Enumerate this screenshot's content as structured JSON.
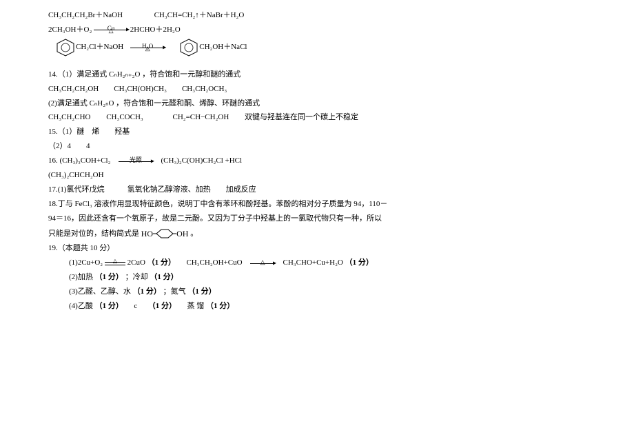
{
  "l1a": "CH₃CH₂CH₂Br＋NaOH",
  "l1b": "CH₃CH=CH₂↑＋NaBr＋H₂O",
  "l2a": "2CH₃OH＋O₂",
  "l2_top": "Cu",
  "l2_bot": "△",
  "l2b": "2HCHO＋2H₂O",
  "l3a": "CH₂Cl＋NaOH",
  "l3_top": "H₂O",
  "l3_bot": "△",
  "l3b": "CH₂OH＋NaCl",
  "q14_1": "14.（1）满足通式 CₙH₂ₙ₊₂O ，符合饱和一元醇和醚的通式",
  "q14_1b": "CH₃CH₂CH₂OH　　CH₃CH(OH)CH₃　　CH₃CH₂OCH₃",
  "q14_2": "(2)满足通式 CₙH₂ₙO ，符合饱和一元醛和酮、烯醇、环醚的通式",
  "q14_2b_a": "CH₃CH₂CHO",
  "q14_2b_b": "CH₃COCH₃",
  "q14_2b_c": "CH₂=CH−CH₂OH",
  "q14_2b_d": "双键与羟基连在同一个碳上不稳定",
  "q15_1": "15.（1）醚　烯　　羟基",
  "q15_2": "（2）4　　4",
  "q16a": "16. (CH₃)₃COH+Cl₂",
  "q16_top": "光照",
  "q16b": "(CH₃)₂C(OH)CH₂Cl +HCl",
  "q16c": "(CH₃)₂CHCH₂OH",
  "q17": "17.(1)氯代环戊烷　　　氢氧化钠乙醇溶液、加热　　加成反应",
  "q18a": "18.丁与 FeCl₃ 溶液作用显现特征颜色，说明丁中含有苯环和酚羟基。苯酚的相对分子质量为 94，110－",
  "q18b": "94＝16，因此还含有一个氧原子，故是二元酚。又因为丁分子中羟基上的一氯取代物只有一种，所以",
  "q18c_pre": "只能是对位的，结构简式是",
  "q18c_ho": "HO",
  "q18c_oh": "OH",
  "q18c_post": "。",
  "q19": "19.（本题共 10 分）",
  "q19_1a": "(1)2Cu+O₂",
  "q19_1b": "2CuO",
  "q19_1p1": "（1 分）",
  "q19_1c": "CH₃CH₂OH+CuO",
  "q19_1d": "CH₃CHO+Cu+H₂O",
  "q19_1p2": "（1 分）",
  "q19_2": "(2)加热",
  "q19_2p1": "（1 分）",
  "q19_2b": "；冷却",
  "q19_2p2": "（1 分）",
  "q19_3": "(3)乙醛、乙醇、水",
  "q19_3p1": "（1 分）",
  "q19_3b": "；氮气",
  "q19_3p2": "（1 分）",
  "q19_4": "(4)乙酸",
  "q19_4p1": "（1 分）",
  "q19_4b": "c",
  "q19_4p2": "（1 分）",
  "q19_4c": "蒸 馏",
  "q19_4p3": "（1 分）",
  "tri": "△"
}
